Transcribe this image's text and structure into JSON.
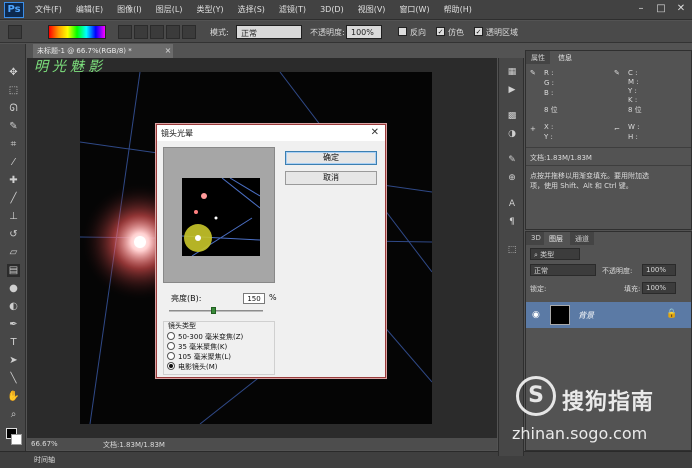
{
  "app": {
    "logo": "Ps"
  },
  "menubar": {
    "items": [
      "文件(F)",
      "编辑(E)",
      "图像(I)",
      "图层(L)",
      "类型(Y)",
      "选择(S)",
      "滤镜(T)",
      "3D(D)",
      "视图(V)",
      "窗口(W)",
      "帮助(H)"
    ]
  },
  "options": {
    "mode_label": "模式:",
    "mode_value": "正常",
    "opacity_label": "不透明度:",
    "opacity_value": "100%",
    "reverse_label": "反向",
    "dither_label": "仿色",
    "transparency_label": "透明区域"
  },
  "document": {
    "tab_title": "未标题-1 @ 66.7%(RGB/8) *",
    "watermark": "明光魅影"
  },
  "status": {
    "zoom": "66.67%",
    "doc_info": "文档:1.83M/1.83M",
    "timeline_label": "时间轴"
  },
  "info_panel": {
    "tab_properties": "属性",
    "tab_info": "信息",
    "rgb_labels": [
      "R :",
      "G :",
      "B :"
    ],
    "cmyk_labels": [
      "C :",
      "M :",
      "Y :",
      "K :"
    ],
    "bits_left": "8 位",
    "bits_right": "8 位",
    "xy_labels": [
      "X :",
      "Y :"
    ],
    "wh_labels": [
      "W :",
      "H :"
    ],
    "doc_size": "文档:1.83M/1.83M",
    "hint_line1": "点按并拖移以用渐变填充。要用附加选",
    "hint_line2": "项，使用 Shift、Alt 和 Ctrl 键。"
  },
  "layers_panel": {
    "tab_3d": "3D",
    "tab_layers": "图层",
    "tab_channels": "通道",
    "kind_label": "类型",
    "blend_mode": "正常",
    "opacity_label": "不透明度:",
    "opacity_value": "100%",
    "lock_label": "锁定:",
    "fill_label": "填充:",
    "fill_value": "100%",
    "layer_name": "背景"
  },
  "dialog": {
    "title": "镜头光晕",
    "ok_label": "确定",
    "cancel_label": "取消",
    "brightness_label": "亮度(B):",
    "brightness_value": "150",
    "brightness_unit": "%",
    "brightness_level": 150,
    "lens_type_label": "镜头类型",
    "lens_options": [
      "50-300 毫米变焦(Z)",
      "35 毫米聚焦(K)",
      "105 毫米聚焦(L)",
      "电影镜头(M)"
    ],
    "selected_lens": "电影镜头(M)"
  },
  "watermark": {
    "brand": "搜狗指南",
    "url": "zhinan.sogo.com",
    "mark": "S"
  },
  "colors": {
    "accent": "#3c7fb1",
    "layer_selected": "#5b7aa5",
    "flare_center": "#ffffff",
    "flare_glow": "#ff7a7a"
  }
}
